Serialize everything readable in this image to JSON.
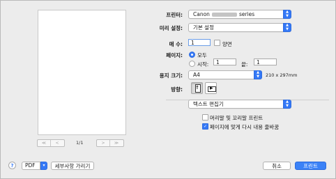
{
  "preview": {
    "page_indicator": "1/1",
    "first_label": "≪",
    "prev_label": "<",
    "next_label": ">",
    "last_label": "≫"
  },
  "printer": {
    "label": "프린터:",
    "value_prefix": "Canon",
    "value_suffix": "series"
  },
  "presets": {
    "label": "미리 설정:",
    "value": "기본 설정"
  },
  "copies": {
    "label": "매 수:",
    "value": "1",
    "two_sided_label": "양면"
  },
  "pages": {
    "label": "페이지:",
    "all_label": "모두",
    "from_label": "시작:",
    "from_value": "1",
    "to_label": "끝:",
    "to_value": "1"
  },
  "paper_size": {
    "label": "용지 크기:",
    "value": "A4",
    "dimensions": "210 x 297mm"
  },
  "orientation": {
    "label": "방향:",
    "portrait_glyph": "↑",
    "landscape_glyph": "▶"
  },
  "section_menu": {
    "value": "텍스트 편집기"
  },
  "options": {
    "header_footer_label": "머리말 및 꼬리말 프린트",
    "header_footer_checked": false,
    "rewrap_label": "페이지에 맞게 다시 내용 줄바꿈",
    "rewrap_checked": true
  },
  "footer": {
    "help_label": "?",
    "pdf_label": "PDF",
    "hide_details_label": "세부사항 가리기",
    "cancel_label": "취소",
    "print_label": "프린트"
  },
  "colors": {
    "accent": "#3478f6",
    "background": "#ececec"
  }
}
